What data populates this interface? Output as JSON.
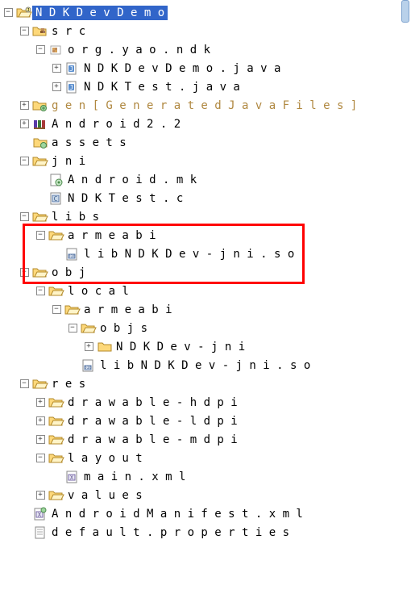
{
  "tree": [
    {
      "d": 0,
      "e": "-",
      "i": "proj-open",
      "t": "NDKDevDemo",
      "sel": true
    },
    {
      "d": 1,
      "e": "-",
      "i": "pkg-fld",
      "t": "src"
    },
    {
      "d": 2,
      "e": "-",
      "i": "pkg",
      "t": "org.yao.ndk"
    },
    {
      "d": 3,
      "e": "+",
      "i": "java",
      "t": "NDKDevDemo.java"
    },
    {
      "d": 3,
      "e": "+",
      "i": "java",
      "t": "NDKTest.java"
    },
    {
      "d": 1,
      "e": "+",
      "i": "gen-fld",
      "t": "gen [Generated Java Files]",
      "gen": true
    },
    {
      "d": 1,
      "e": "+",
      "i": "lib",
      "t": "Android 2.2"
    },
    {
      "d": 1,
      "e": null,
      "i": "fld-dec",
      "t": "assets"
    },
    {
      "d": 1,
      "e": "-",
      "i": "fld-open",
      "t": "jni"
    },
    {
      "d": 2,
      "e": null,
      "i": "mk",
      "t": "Android.mk"
    },
    {
      "d": 2,
      "e": null,
      "i": "cfile",
      "t": "NDKTest.c"
    },
    {
      "d": 1,
      "e": "-",
      "i": "fld-open",
      "t": "libs"
    },
    {
      "d": 2,
      "e": "-",
      "i": "fld-open",
      "t": "armeabi"
    },
    {
      "d": 3,
      "e": null,
      "i": "bin",
      "t": "libNDKDev-jni.so"
    },
    {
      "d": 1,
      "e": "-",
      "i": "fld-open",
      "t": "obj"
    },
    {
      "d": 2,
      "e": "-",
      "i": "fld-open",
      "t": "local"
    },
    {
      "d": 3,
      "e": "-",
      "i": "fld-open",
      "t": "armeabi"
    },
    {
      "d": 4,
      "e": "-",
      "i": "fld-open",
      "t": "objs"
    },
    {
      "d": 5,
      "e": "+",
      "i": "fld",
      "t": "NDKDev-jni"
    },
    {
      "d": 4,
      "e": null,
      "i": "bin",
      "t": "libNDKDev-jni.so"
    },
    {
      "d": 1,
      "e": "-",
      "i": "fld-open",
      "t": "res"
    },
    {
      "d": 2,
      "e": "+",
      "i": "fld-open",
      "t": "drawable-hdpi"
    },
    {
      "d": 2,
      "e": "+",
      "i": "fld-open",
      "t": "drawable-ldpi"
    },
    {
      "d": 2,
      "e": "+",
      "i": "fld-open",
      "t": "drawable-mdpi"
    },
    {
      "d": 2,
      "e": "-",
      "i": "fld-open",
      "t": "layout"
    },
    {
      "d": 3,
      "e": null,
      "i": "xml",
      "t": "main.xml"
    },
    {
      "d": 2,
      "e": "+",
      "i": "fld-open",
      "t": "values"
    },
    {
      "d": 1,
      "e": null,
      "i": "xmla",
      "t": "AndroidManifest.xml"
    },
    {
      "d": 1,
      "e": null,
      "i": "file",
      "t": "default.properties"
    }
  ]
}
